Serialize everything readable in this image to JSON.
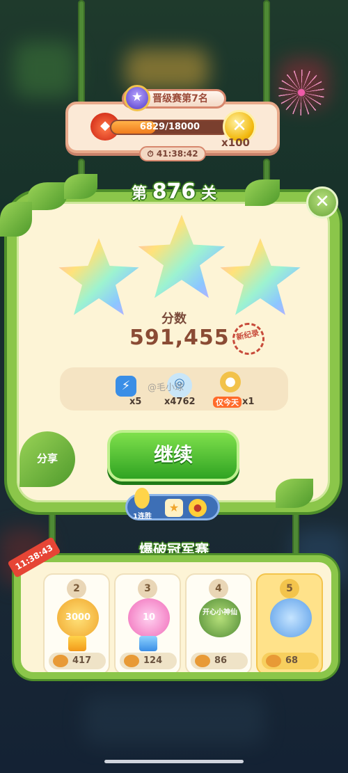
{
  "promo": {
    "title": "晋级赛第7名",
    "progress_text": "6829/18000",
    "progress_fraction": 0.379,
    "coin_icon": "✕",
    "coin_count": "x100",
    "timer": "41:38:42"
  },
  "level": {
    "prefix": "第",
    "number": "876",
    "suffix": "关",
    "close_icon": "✕",
    "stars_earned": 3,
    "score_label": "分数",
    "score": "591,455",
    "record_stamp": "新纪录"
  },
  "items": [
    {
      "icon": "lightning-icon",
      "count": "x5"
    },
    {
      "icon": "coin-stack-icon",
      "count": "x4762"
    },
    {
      "icon": "potion-icon",
      "tag": "仅今天",
      "count": "x1"
    }
  ],
  "watermark": "@毛小球",
  "actions": {
    "continue": "继续",
    "share": "分享",
    "streak": "1连胜"
  },
  "championship": {
    "title": "爆破冠军赛",
    "timer": "11:38:43",
    "cards": [
      {
        "rank": "2",
        "badge": "3000",
        "score": "417"
      },
      {
        "rank": "3",
        "badge": "10",
        "score": "124"
      },
      {
        "rank": "4",
        "badge": "开心小神仙",
        "score": "86"
      },
      {
        "rank": "5",
        "badge": "",
        "score": "68"
      }
    ]
  },
  "colors": {
    "accent_green": "#8bc64a",
    "panel_cream": "#fdf4d6",
    "score_brown": "#8a4b34",
    "button_green": "#2fa322"
  }
}
